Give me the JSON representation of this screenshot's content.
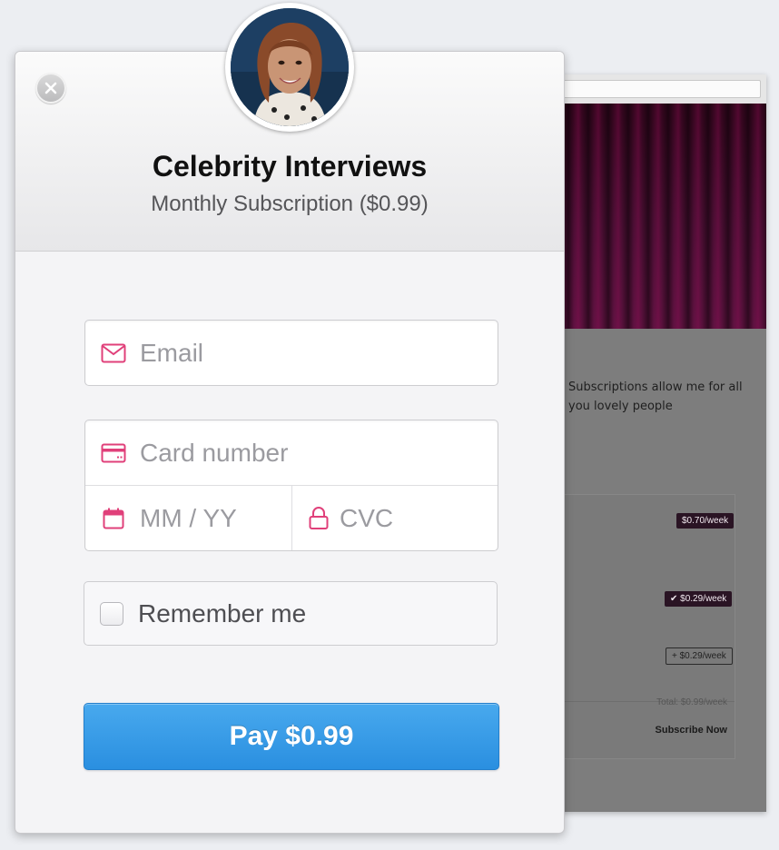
{
  "modal": {
    "title": "Celebrity Interviews",
    "subtitle": "Monthly Subscription ($0.99)",
    "email_placeholder": "Email",
    "card_number_placeholder": "Card number",
    "expiry_placeholder": "MM / YY",
    "cvc_placeholder": "CVC",
    "remember_label": "Remember me",
    "pay_label": "Pay $0.99",
    "accent_color": "#e0407a",
    "button_color": "#3b9fe8",
    "icons": [
      "close-icon",
      "mail-icon",
      "credit-card-icon",
      "calendar-icon",
      "lock-icon"
    ]
  },
  "background": {
    "text": "Subscriptions allow me for all you lovely people",
    "pills": [
      "$0.70/week",
      "✔ $0.29/week",
      "+ $0.29/week"
    ],
    "total": "Total: $0.99/week",
    "subscribe": "Subscribe Now"
  }
}
